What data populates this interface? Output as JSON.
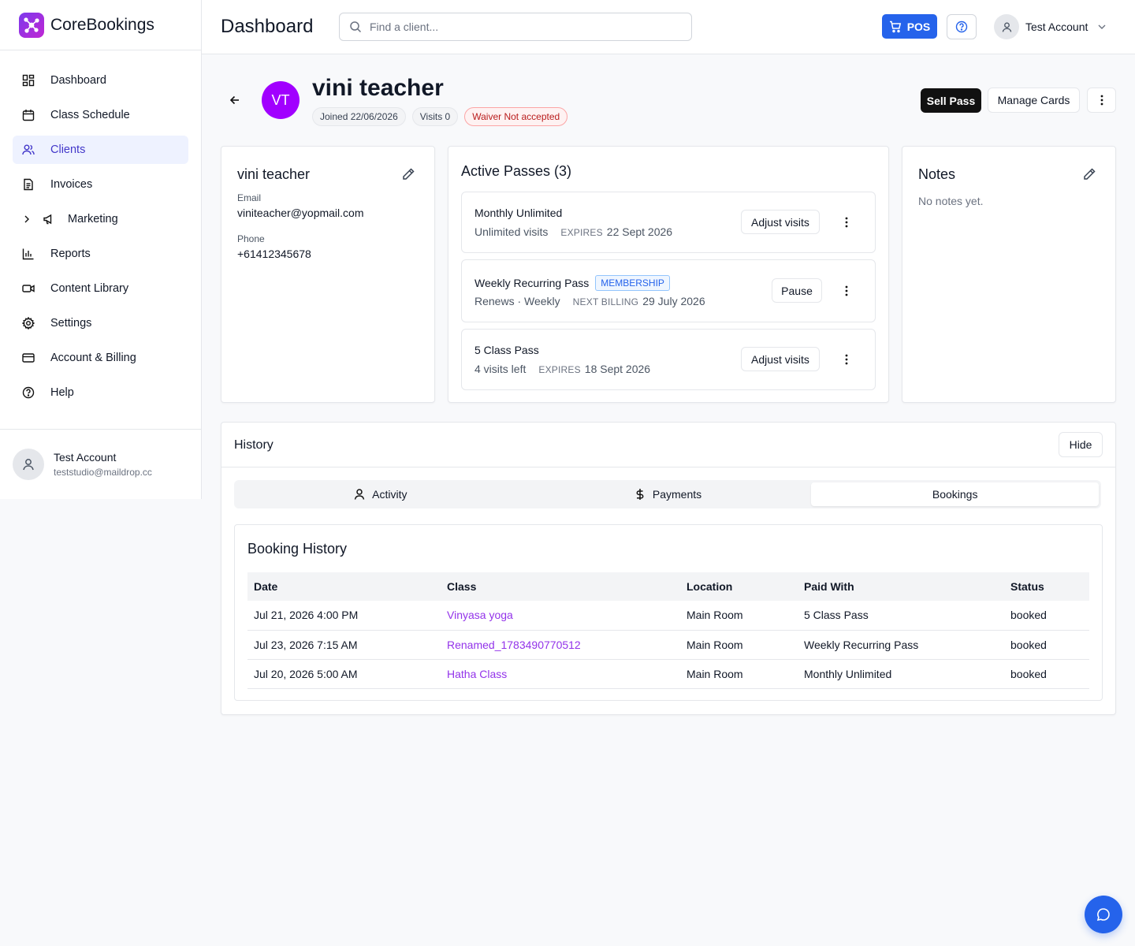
{
  "brand": {
    "name": "CoreBookings"
  },
  "sidebar": {
    "items": [
      {
        "label": "Dashboard",
        "icon": "dashboard-grid-icon"
      },
      {
        "label": "Class Schedule",
        "icon": "calendar-icon"
      },
      {
        "label": "Clients",
        "icon": "users-icon"
      },
      {
        "label": "Invoices",
        "icon": "document-icon"
      },
      {
        "label": "Marketing",
        "icon": "megaphone-icon"
      },
      {
        "label": "Reports",
        "icon": "bar-chart-icon"
      },
      {
        "label": "Content Library",
        "icon": "video-icon"
      },
      {
        "label": "Settings",
        "icon": "gear-icon"
      },
      {
        "label": "Account & Billing",
        "icon": "credit-card-icon"
      },
      {
        "label": "Help",
        "icon": "help-circle-icon"
      }
    ],
    "active_index": 2,
    "user": {
      "name": "Test Account",
      "email": "teststudio@maildrop.cc"
    }
  },
  "header": {
    "title": "Dashboard",
    "search_placeholder": "Find a client...",
    "pos_label": "POS",
    "account_name": "Test Account"
  },
  "client": {
    "initials": "VT",
    "name": "vini teacher",
    "joined": "Joined 22/06/2026",
    "visits": "Visits 0",
    "waiver": "Waiver Not accepted",
    "actions": {
      "sell_pass": "Sell Pass",
      "manage_cards": "Manage Cards"
    }
  },
  "details": {
    "name": "vini teacher",
    "email_label": "Email",
    "email": "viniteacher@yopmail.com",
    "phone_label": "Phone",
    "phone": "+61412345678"
  },
  "passes": {
    "title": "Active Passes (3)",
    "items": [
      {
        "name": "Monthly Unlimited",
        "badge": "",
        "info": "Unlimited visits",
        "cap": "EXPIRES",
        "date": "22 Sept 2026",
        "action": "Adjust visits"
      },
      {
        "name": "Weekly Recurring Pass",
        "badge": "MEMBERSHIP",
        "info": "Renews · Weekly",
        "cap": "NEXT BILLING",
        "date": "29 July 2026",
        "action": "Pause"
      },
      {
        "name": "5 Class Pass",
        "badge": "",
        "info": "4 visits left",
        "cap": "EXPIRES",
        "date": "18 Sept 2026",
        "action": "Adjust visits"
      }
    ]
  },
  "notes": {
    "title": "Notes",
    "empty": "No notes yet."
  },
  "history": {
    "title": "History",
    "hide_label": "Hide",
    "tabs": [
      {
        "label": "Activity",
        "icon": "user-icon"
      },
      {
        "label": "Payments",
        "icon": "dollar-icon"
      },
      {
        "label": "Bookings",
        "icon": ""
      }
    ],
    "active_tab": 2,
    "booking_title": "Booking History",
    "columns": [
      "Date",
      "Class",
      "Location",
      "Paid With",
      "Status"
    ],
    "rows": [
      [
        "Jul 21, 2026 4:00 PM",
        "Vinyasa yoga",
        "Main Room",
        "5 Class Pass",
        "booked"
      ],
      [
        "Jul 23, 2026 7:15 AM",
        "Renamed_1783490770512",
        "Main Room",
        "Weekly Recurring Pass",
        "booked"
      ],
      [
        "Jul 20, 2026 5:00 AM",
        "Hatha Class",
        "Main Room",
        "Monthly Unlimited",
        "booked"
      ]
    ]
  },
  "colors": {
    "accent": "#2563eb",
    "avatar": "#a100ff",
    "link": "#9333ea",
    "active_nav": "#eef2ff"
  }
}
